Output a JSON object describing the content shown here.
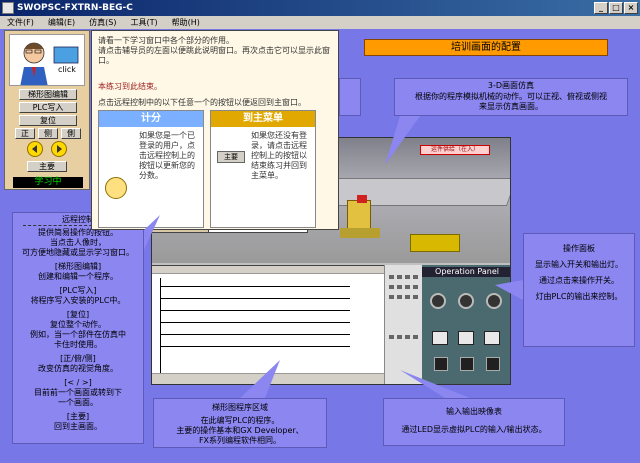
{
  "window": {
    "title": "SWOPSC-FXTRN-BEG-C",
    "controls": [
      "_",
      "□",
      "×"
    ]
  },
  "menu": [
    "文件(F)",
    "编辑(E)",
    "仿真(S)",
    "工具(T)",
    "帮助(H)"
  ],
  "control_panel": {
    "teacher_label": "click",
    "buttons": {
      "edit_ladder": "梯形图编辑",
      "plc_write": "PLC写入",
      "reset": "复位",
      "front": "正",
      "side": "侧",
      "back": "側",
      "home": "主要"
    },
    "status": "学习中"
  },
  "help_popup": {
    "intro": "请看一下学习窗口中各个部分的作用。",
    "instruction": "请点击辅导员的左面以便跳此说明窗口。再次点击它可以显示此窗口。",
    "note": "本练习到此结束。",
    "prompt": "点击远程控制中的以下任意一个的按钮以便返回到主窗口。",
    "card_score": {
      "title": "计分",
      "body": "如果您是一个已登录的用户，点击远程控制上的按钮以更新您的分数。",
      "highlight": "分数"
    },
    "card_main": {
      "title": "到主菜单",
      "body": "如果您还没有登录，请点击远程控制上的按钮以结束练习并回到主菜单。",
      "highlight": "主菜单",
      "icon_label": "主要"
    }
  },
  "banner": "培训画面的配置",
  "callouts": {
    "sim3d": {
      "title": "3-D画面仿真",
      "text": "根据你的程序模拟机械的动作。可以正视、俯视或侧视来显示仿真画面。"
    },
    "remote": {
      "title": "远程控制",
      "lines": [
        "提供简易操作的按钮。",
        "当点击人像时，",
        "可方便地隐藏或显示学习窗口。",
        "[梯形图编辑]",
        "创建和编辑一个程序。",
        "[PLC写入]",
        "将程序写入安装的PLC中。",
        "[复位]",
        "复位整个动作。",
        "例如，当一个部件在仿真中",
        "卡住时使用。",
        "[正/俯/侧]",
        "改变仿真的视觉角度。",
        "[< / >]",
        "目前前一个画面或转到下",
        "一个画面。",
        "[主要]",
        "回到主画面。"
      ]
    },
    "oppanel": {
      "title": "操作面板",
      "lines": [
        "显示输入开关和输出灯。",
        "通过点击来操作开关。",
        "灯由PLC的输出来控制。"
      ]
    },
    "ladder": {
      "title": "梯形图程序区域",
      "lines": [
        "在此编写PLC的程序。",
        "主要的操作基本和GX Developer、",
        "FX系列编程软件相同。"
      ]
    },
    "io": {
      "title": "输入输出映像表",
      "lines": [
        "通过LED显示虚拟PLC的输入/输出状态。"
      ]
    }
  },
  "sim": {
    "operation_panel_title": "Operation Panel",
    "scene_tag": "运件供给（在入）"
  },
  "colors": {
    "workspace": "#7777e8",
    "banner": "#ff9a00",
    "callout": "#8b86f0",
    "score_header": "#7ab0ff",
    "main_header": "#e0a800"
  }
}
